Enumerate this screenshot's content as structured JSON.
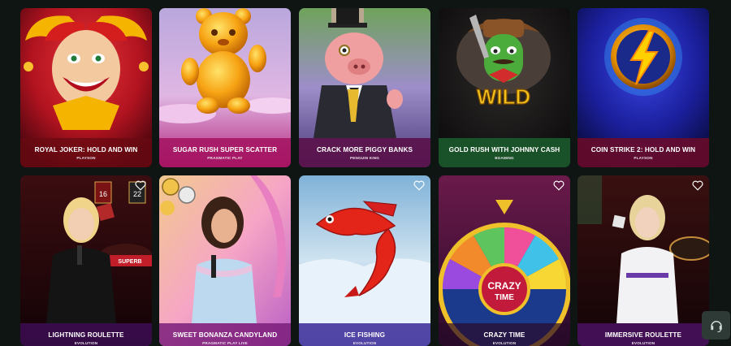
{
  "games": [
    {
      "title": "ROYAL JOKER: HOLD AND WIN",
      "provider": "PLAYSON"
    },
    {
      "title": "SUGAR RUSH SUPER SCATTER",
      "provider": "PRAGMATIC PLAY"
    },
    {
      "title": "CRACK MORE PIGGY BANKS",
      "provider": "PENGUIN KING"
    },
    {
      "title": "GOLD RUSH WITH JOHNNY CASH",
      "provider": "BGAMING"
    },
    {
      "title": "COIN STRIKE 2: HOLD AND WIN",
      "provider": "PLAYSON"
    },
    {
      "title": "LIGHTNING ROULETTE",
      "provider": "EVOLUTION"
    },
    {
      "title": "SWEET BONANZA CANDYLAND",
      "provider": "PRAGMATIC PLAY LIVE"
    },
    {
      "title": "ICE FISHING",
      "provider": "EVOLUTION"
    },
    {
      "title": "CRAZY TIME",
      "provider": "EVOLUTION"
    },
    {
      "title": "IMMERSIVE ROULETTE",
      "provider": "EVOLUTION"
    }
  ],
  "art_text": {
    "wild": "WILD",
    "crazy": "CRAZY",
    "time": "TIME",
    "superbet": "SUPERB"
  },
  "icons": {
    "favorite": "heart-icon",
    "support": "headset-icon"
  },
  "colors": {
    "background": "#0e1513",
    "support_button": "#2d3a36"
  }
}
